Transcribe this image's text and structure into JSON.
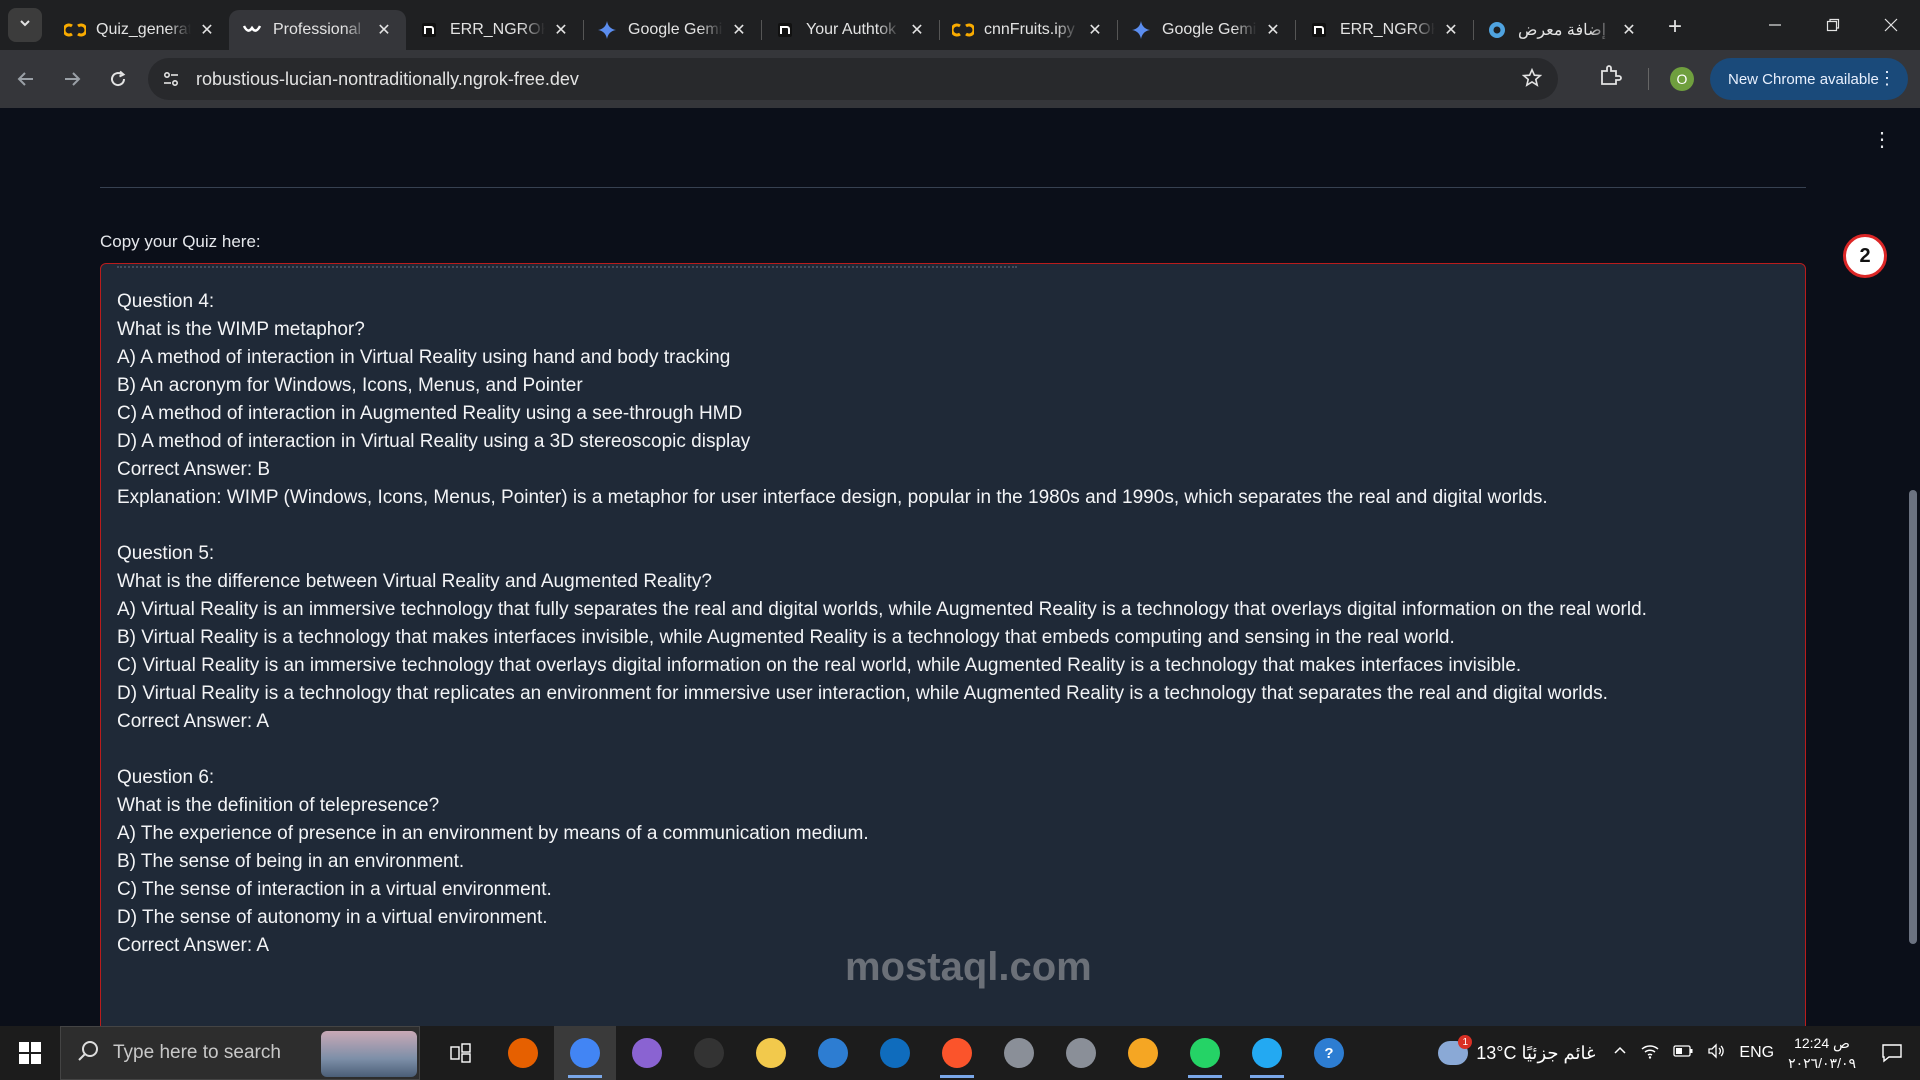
{
  "browser": {
    "tabs": [
      {
        "title": "Quiz_generat",
        "icon": "colab-icon",
        "active": false
      },
      {
        "title": "Professional",
        "icon": "gradio-icon",
        "active": true
      },
      {
        "title": "ERR_NGROK_",
        "icon": "ngrok-icon",
        "active": false
      },
      {
        "title": "Google Gemi",
        "icon": "gemini-icon",
        "active": false
      },
      {
        "title": "Your Authtok",
        "icon": "ngrok-icon",
        "active": false
      },
      {
        "title": "cnnFruits.ipy",
        "icon": "colab-icon",
        "active": false
      },
      {
        "title": "Google Gemi",
        "icon": "gemini-icon",
        "active": false
      },
      {
        "title": "ERR_NGROK",
        "icon": "ngrok-icon",
        "active": false
      },
      {
        "title": "إضافة معرض",
        "icon": "circle-icon",
        "active": false
      }
    ],
    "url": "robustious-lucian-nontraditionally.ngrok-free.dev",
    "profile_initial": "O",
    "update_label": "New Chrome available"
  },
  "page": {
    "field_label": "Copy your Quiz here:",
    "badge_count": "2",
    "quiz_text": "Question 4:\nWhat is the WIMP metaphor?\nA) A method of interaction in Virtual Reality using hand and body tracking\nB) An acronym for Windows, Icons, Menus, and Pointer\nC) A method of interaction in Augmented Reality using a see-through HMD\nD) A method of interaction in Virtual Reality using a 3D stereoscopic display\nCorrect Answer: B\nExplanation: WIMP (Windows, Icons, Menus, Pointer) is a metaphor for user interface design, popular in the 1980s and 1990s, which separates the real and digital worlds.\n\nQuestion 5:\nWhat is the difference between Virtual Reality and Augmented Reality?\nA) Virtual Reality is an immersive technology that fully separates the real and digital worlds, while Augmented Reality is a technology that overlays digital information on the real world.\nB) Virtual Reality is a technology that makes interfaces invisible, while Augmented Reality is a technology that embeds computing and sensing in the real world.\nC) Virtual Reality is an immersive technology that overlays digital information on the real world, while Augmented Reality is a technology that makes interfaces invisible.\nD) Virtual Reality is a technology that replicates an environment for immersive user interaction, while Augmented Reality is a technology that separates the real and digital worlds.\nCorrect Answer: A\n\nQuestion 6:\nWhat is the definition of telepresence?\nA) The experience of presence in an environment by means of a communication medium.\nB) The sense of being in an environment.\nC) The sense of interaction in a virtual environment.\nD) The sense of autonomy in a virtual environment.\nCorrect Answer: A",
    "watermark": "mostaql.com"
  },
  "taskbar": {
    "search_placeholder": "Type here to search",
    "weather": "13°C غائم جزئيًا",
    "language": "ENG",
    "time": "12:24 ص",
    "date": "٢٠٢٦/٠٣/٠٩",
    "apps": [
      {
        "name": "task-view-icon",
        "label": "",
        "color": "#1c1c1c",
        "running": false,
        "active": false
      },
      {
        "name": "firefox-icon",
        "label": "",
        "color": "#e66000",
        "running": false,
        "active": false
      },
      {
        "name": "chrome-icon",
        "label": "",
        "color": "#4285f4",
        "running": true,
        "active": true
      },
      {
        "name": "copilot-icon",
        "label": "",
        "color": "#8a63d2",
        "running": false,
        "active": false
      },
      {
        "name": "terminal-icon",
        "label": "",
        "color": "#333333",
        "running": false,
        "active": false
      },
      {
        "name": "file-explorer-icon",
        "label": "",
        "color": "#f2c94c",
        "running": false,
        "active": false
      },
      {
        "name": "store-icon",
        "label": "",
        "color": "#2d7dd2",
        "running": false,
        "active": false
      },
      {
        "name": "outlook-icon",
        "label": "",
        "color": "#0f6cbd",
        "running": false,
        "active": false
      },
      {
        "name": "brave-icon",
        "label": "",
        "color": "#fb542b",
        "running": true,
        "active": false
      },
      {
        "name": "app-icon-1",
        "label": "",
        "color": "#8a8f98",
        "running": false,
        "active": false
      },
      {
        "name": "app-icon-2",
        "label": "",
        "color": "#8a8f98",
        "running": false,
        "active": false
      },
      {
        "name": "vpn-icon",
        "label": "",
        "color": "#f5a623",
        "running": false,
        "active": false
      },
      {
        "name": "whatsapp-icon",
        "label": "",
        "color": "#25d366",
        "running": true,
        "active": false
      },
      {
        "name": "vscode-icon",
        "label": "",
        "color": "#23a9f2",
        "running": true,
        "active": false
      },
      {
        "name": "help-icon",
        "label": "?",
        "color": "#2d7dd2",
        "running": false,
        "active": false
      }
    ]
  }
}
